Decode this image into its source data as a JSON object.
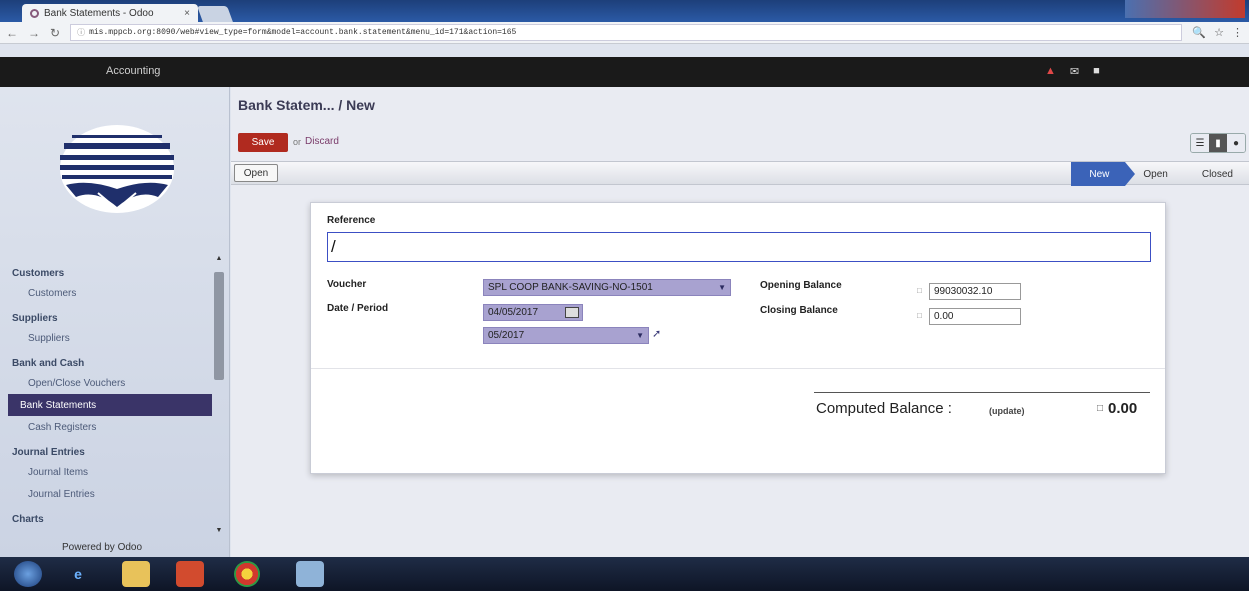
{
  "browser": {
    "tab_title": "Bank Statements - Odoo",
    "tab_close": "×",
    "url": "mis.mppcb.org:8090/web#view_type=form&model=account.bank.statement&menu_id=171&action=165"
  },
  "topbar": {
    "app_menu": "Accounting"
  },
  "sidebar": {
    "sections": [
      {
        "header": "Customers",
        "items": [
          {
            "label": "Customers",
            "active": false
          }
        ]
      },
      {
        "header": "Suppliers",
        "items": [
          {
            "label": "Suppliers",
            "active": false
          }
        ]
      },
      {
        "header": "Bank and Cash",
        "items": [
          {
            "label": "Open/Close Vouchers",
            "active": false
          },
          {
            "label": "Bank Statements",
            "active": true
          },
          {
            "label": "Cash Registers",
            "active": false
          }
        ]
      },
      {
        "header": "Journal Entries",
        "items": [
          {
            "label": "Journal Items",
            "active": false
          },
          {
            "label": "Journal Entries",
            "active": false
          }
        ]
      },
      {
        "header": "Charts",
        "items": []
      }
    ],
    "powered_by": "Powered by Odoo"
  },
  "header": {
    "breadcrumb": "Bank Statem... / New",
    "save_label": "Save",
    "or_label": "or",
    "discard_label": "Discard"
  },
  "statusbar": {
    "open_button": "Open",
    "states": [
      {
        "label": "New",
        "current": true
      },
      {
        "label": "Open",
        "current": false
      },
      {
        "label": "Closed",
        "current": false
      }
    ]
  },
  "form": {
    "reference_label": "Reference",
    "reference_value": "/",
    "voucher_label": "Voucher",
    "voucher_value": "SPL COOP BANK-SAVING-NO-1501",
    "date_period_label": "Date / Period",
    "date_value": "04/05/2017",
    "period_value": "05/2017",
    "opening_balance_label": "Opening Balance",
    "opening_balance_value": "99030032.10",
    "closing_balance_label": "Closing Balance",
    "closing_balance_value": "0.00",
    "computed_balance_label": "Computed Balance :",
    "update_label": "(update)",
    "computed_balance_value": "0.00"
  }
}
